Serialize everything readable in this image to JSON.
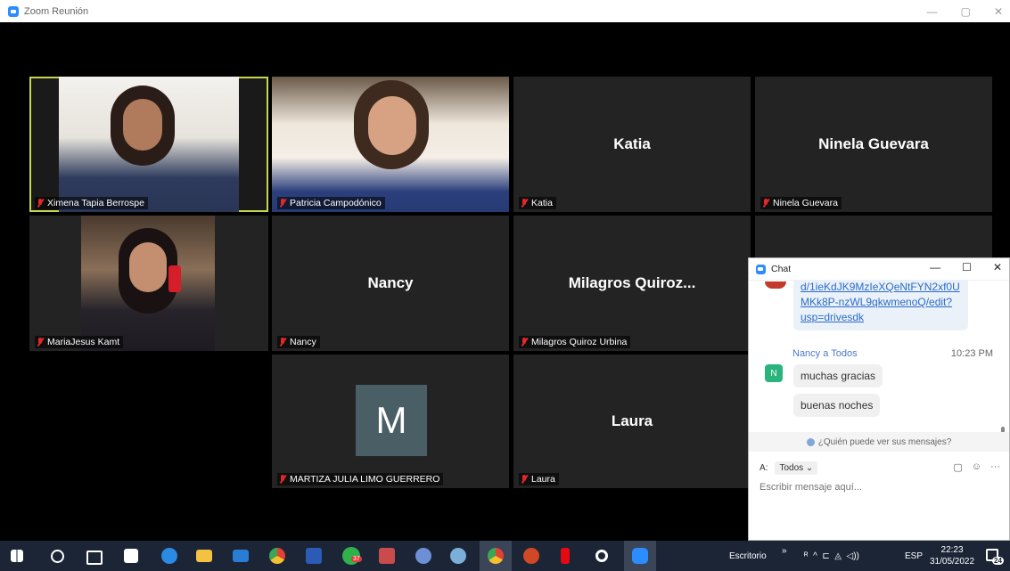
{
  "window": {
    "title": "Zoom Reunión",
    "controls": [
      "—",
      "▢",
      "✕"
    ]
  },
  "participants": [
    {
      "id": "ximena",
      "name": "Ximena Tapia Berrospe",
      "display": "",
      "video": true
    },
    {
      "id": "patricia",
      "name": "Patricia Campodónico",
      "display": "",
      "video": true
    },
    {
      "id": "katia",
      "name": "Katia",
      "display": "Katia",
      "video": false
    },
    {
      "id": "ninela",
      "name": "Ninela Guevara",
      "display": "Ninela Guevara",
      "video": false
    },
    {
      "id": "mariajesus",
      "name": "MariaJesus Kamt",
      "display": "",
      "video": true
    },
    {
      "id": "nancy",
      "name": "Nancy",
      "display": "Nancy",
      "video": false
    },
    {
      "id": "milagros",
      "name": "Milagros Quiroz Urbina",
      "display": "Milagros  Quiroz...",
      "video": false
    },
    {
      "id": "martiza",
      "name": "MARTIZA JULIA LIMO GUERRERO",
      "display": "",
      "avatar_letter": "M",
      "video": false
    },
    {
      "id": "laura",
      "name": "Laura",
      "display": "Laura",
      "video": false
    }
  ],
  "chat": {
    "title": "Chat",
    "controls": [
      "—",
      "☐",
      "✕"
    ],
    "link_lines": [
      "d/1ieKdJK9MzIeXQeNtFYN2xf0U",
      "MKk8P-nzWL9qkwmenoQ/edit?",
      "usp=drivesdk"
    ],
    "sender": "Nancy a Todos",
    "time": "10:23 PM",
    "avatar_letter": "N",
    "messages": [
      "muchas gracias",
      "buenas noches"
    ],
    "who_can_see": "¿Quién puede ver sus mensajes?",
    "to_label": "A:",
    "to_value": "Todos ⌄",
    "input_placeholder": "Escribir mensaje aquí..."
  },
  "taskbar": {
    "desktop_label": "Escritorio",
    "chevron": "»",
    "tray_glyphs": "ᴿ  ^  ⊏  ◬  ◁))",
    "language": "ESP",
    "time": "22:23",
    "date": "31/05/2022",
    "notification_count": "24",
    "mail_badge": "37"
  },
  "colors": {
    "zoom_blue": "#2d8cff",
    "active_speaker": "#c7d74e",
    "muted_mic": "#e02828",
    "tile_bg": "#232323"
  }
}
